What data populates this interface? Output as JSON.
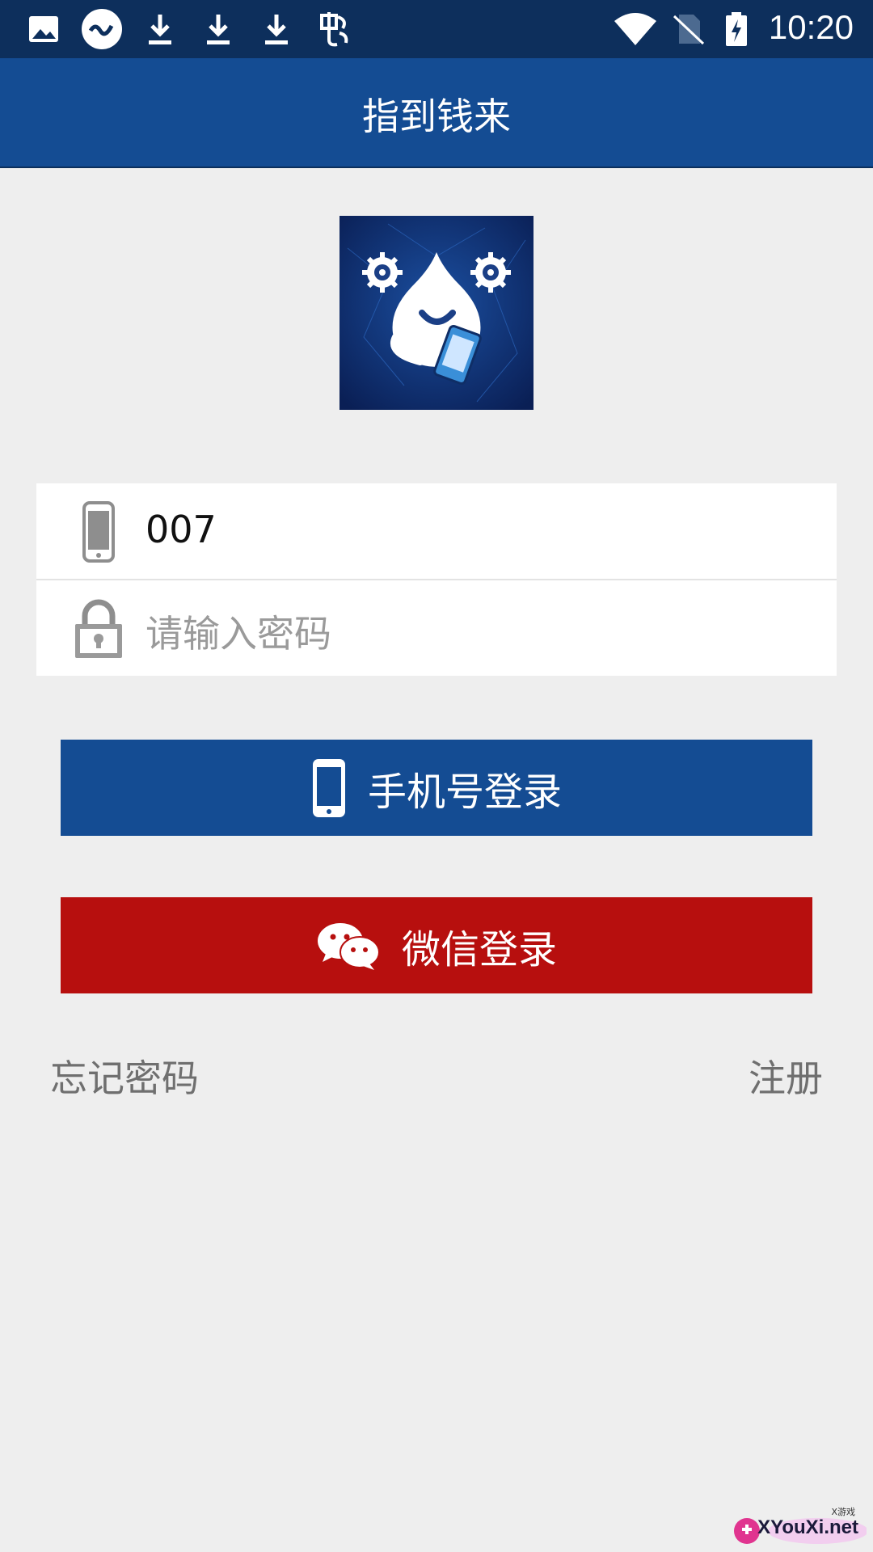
{
  "status_bar": {
    "time": "10:20",
    "left_icons": [
      "image-icon",
      "app-badge-icon",
      "download-icon",
      "download-icon",
      "download-icon",
      "chinese-app-icon"
    ],
    "right_icons": [
      "wifi-icon",
      "no-sim-icon",
      "battery-charging-icon"
    ]
  },
  "app_bar": {
    "title": "指到钱来"
  },
  "login": {
    "phone_value": "007",
    "password_placeholder": "请输入密码"
  },
  "buttons": {
    "phone_login": "手机号登录",
    "wechat_login": "微信登录"
  },
  "links": {
    "forgot_password": "忘记密码",
    "register": "注册"
  },
  "watermark": {
    "text": "XYouXi.net",
    "small": "X游戏"
  },
  "colors": {
    "status_bar": "#0d2f5c",
    "primary": "#144c93",
    "wechat": "#b70f0e",
    "background": "#eeeeee"
  }
}
